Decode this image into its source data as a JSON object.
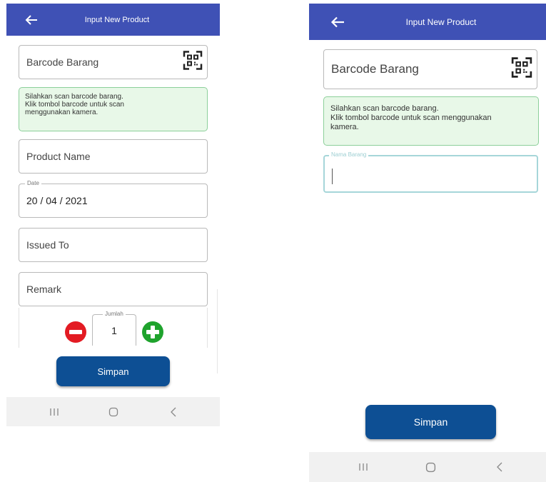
{
  "screen1": {
    "appbar": {
      "title": "Input New Product"
    },
    "barcode": {
      "placeholder": "Barcode Barang"
    },
    "info": {
      "line1": "Silahkan scan barcode barang.",
      "line2": "Klik tombol barcode untuk scan",
      "line3": "menggunakan kamera."
    },
    "product_name": {
      "placeholder": "Product Name"
    },
    "date": {
      "label": "Date",
      "value": "20 / 04 / 2021"
    },
    "issued_to": {
      "placeholder": "Issued To"
    },
    "remark": {
      "placeholder": "Remark"
    },
    "quantity": {
      "label": "Jumlah",
      "value": "1"
    },
    "save_label": "Simpan"
  },
  "screen2": {
    "appbar": {
      "title": "Input New Product"
    },
    "barcode": {
      "placeholder": "Barcode Barang"
    },
    "info": {
      "line1": "Silahkan scan barcode barang.",
      "line2": "Klik tombol barcode untuk scan menggunakan",
      "line3": "kamera."
    },
    "nama_barang": {
      "label": "Nama Barang",
      "value": ""
    },
    "save_label": "Simpan"
  },
  "icons": {
    "back": "arrow-left-icon",
    "qr": "qr-code-icon",
    "minus": "minus-circle-icon",
    "plus": "plus-circle-icon",
    "nav_recents": "recents-icon",
    "nav_home": "home-icon",
    "nav_back": "back-nav-icon"
  },
  "colors": {
    "appbar": "#3f51b5",
    "button": "#0d4f94",
    "info_bg": "#e8f8e8",
    "info_border": "#8ccf9a",
    "minus": "#e31b23",
    "plus": "#1fa32d"
  }
}
